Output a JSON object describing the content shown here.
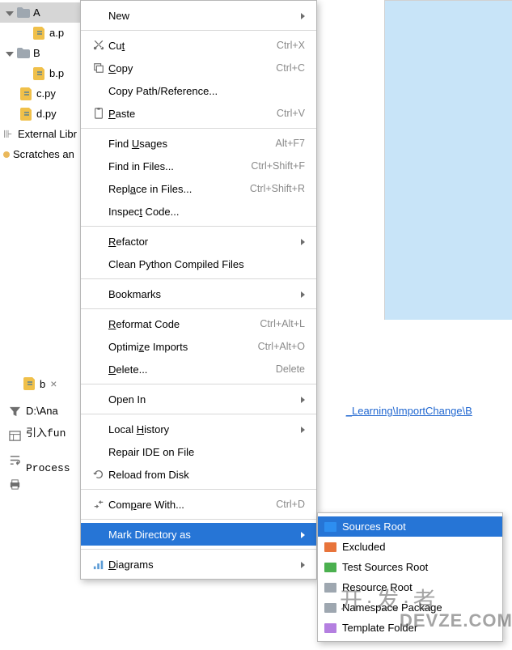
{
  "tree": {
    "a_folder": "A",
    "a_py": "a.p",
    "b_folder": "B",
    "b_py": "b.p",
    "c_py": "c.py",
    "d_py": "d.py",
    "ext_lib": "External Libr",
    "scratches": "Scratches an"
  },
  "tab": {
    "label": "b"
  },
  "run": {
    "path_prefix": "D:\\Ana",
    "path_link": "_Learning\\ImportChange\\B",
    "line2_prefix": "引入fun",
    "proc": "Process"
  },
  "ctx": {
    "new": "New",
    "cut": {
      "label_pre": "",
      "u": "t",
      "post": "",
      "full": "Cut",
      "sc": "Ctrl+X"
    },
    "copy": {
      "u": "C",
      "post": "opy",
      "sc": "Ctrl+C"
    },
    "copypath": "Copy Path/Reference...",
    "paste": {
      "u": "P",
      "post": "aste",
      "sc": "Ctrl+V"
    },
    "findusages": {
      "pre": "Find ",
      "u": "U",
      "post": "sages",
      "sc": "Alt+F7"
    },
    "findfiles": {
      "label": "Find in Files...",
      "sc": "Ctrl+Shift+F"
    },
    "replace": {
      "pre": "Repl",
      "u": "a",
      "post": "ce in Files...",
      "sc": "Ctrl+Shift+R"
    },
    "inspect": {
      "pre": "Inspec",
      "u": "t",
      "post": " Code..."
    },
    "refactor": {
      "u": "R",
      "post": "efactor"
    },
    "clean": "Clean Python Compiled Files",
    "bookmarks": "Bookmarks",
    "reformat": {
      "pre": "",
      "u": "R",
      "post": "eformat Code",
      "sc": "Ctrl+Alt+L"
    },
    "optimize": {
      "pre": "Optimi",
      "u": "z",
      "post": "e Imports",
      "sc": "Ctrl+Alt+O"
    },
    "delete": {
      "u": "D",
      "post": "elete...",
      "sc": "Delete"
    },
    "openin": "Open In",
    "localhist": {
      "pre": "Local ",
      "u": "H",
      "post": "istory"
    },
    "repair": "Repair IDE on File",
    "reload": "Reload from Disk",
    "compare": {
      "pre": "Com",
      "u": "p",
      "post": "are With...",
      "sc": "Ctrl+D"
    },
    "markdir": "Mark Directory as",
    "diagrams": {
      "u": "D",
      "post": "iagrams"
    }
  },
  "sub": {
    "sources": {
      "label": "Sources Root",
      "color": "#2d8ef0"
    },
    "excluded": {
      "label": "Excluded",
      "color": "#e8743b"
    },
    "tests": {
      "label": "Test Sources Root",
      "color": "#4bb04f"
    },
    "resource": {
      "label": "Resource Root",
      "color": "#9ea7b0"
    },
    "namespace": {
      "label": "Namespace Package",
      "color": "#9ea7b0"
    },
    "template": {
      "label": "Template Folder",
      "color": "#b47fe0"
    }
  },
  "wm1": "开·发·者",
  "wm2": "DEVZE.COM"
}
